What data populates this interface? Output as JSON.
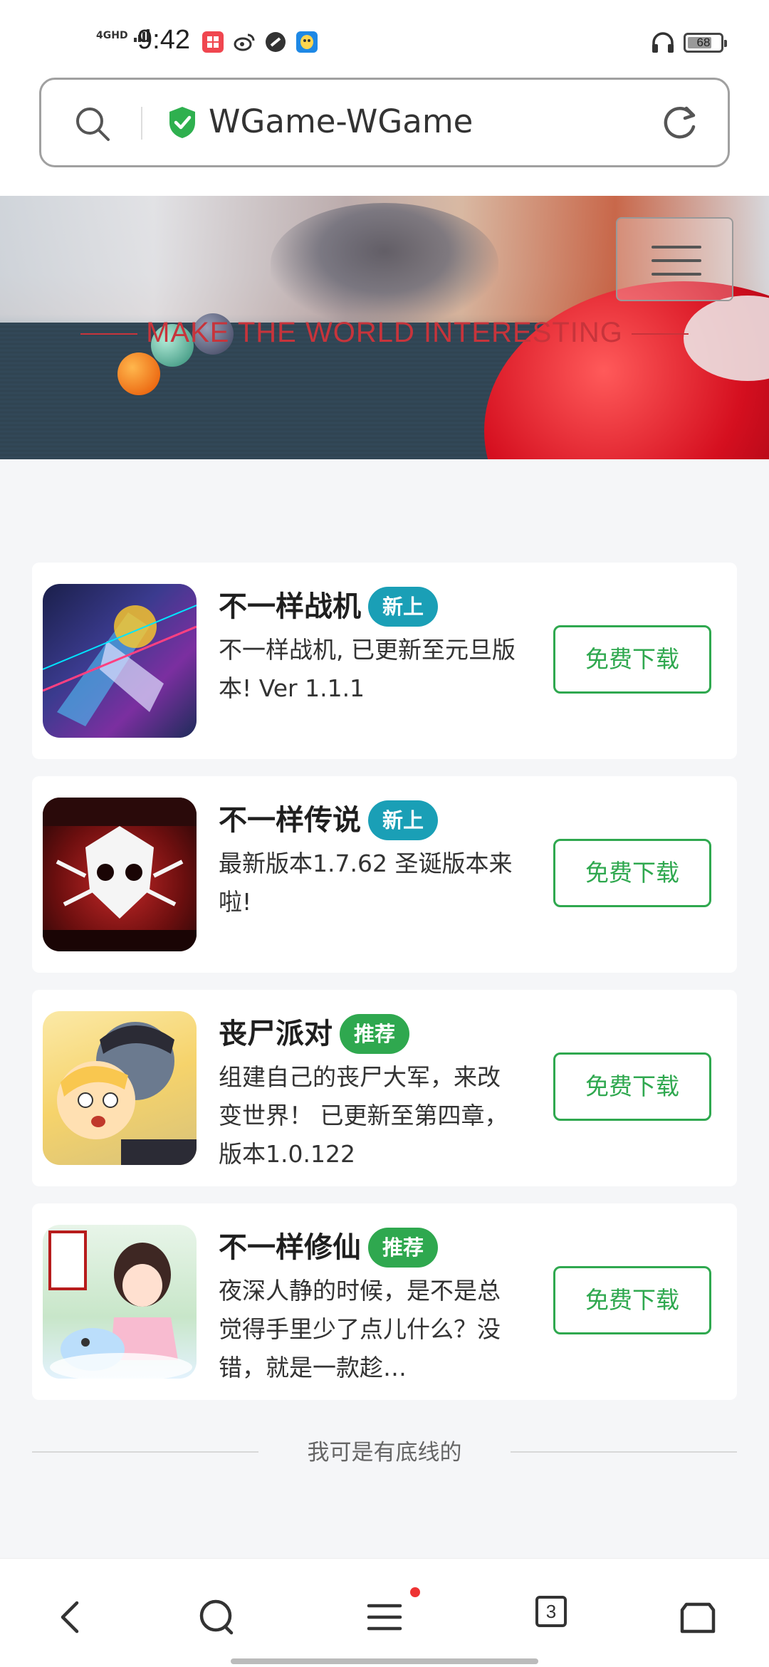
{
  "status_bar": {
    "network": "4GHD",
    "time": "9:42",
    "battery": "68",
    "app_icons": [
      "app-red-icon",
      "weibo-icon",
      "circle-app-icon",
      "qq-icon"
    ],
    "headphone_icon": "headphones-icon"
  },
  "address_bar": {
    "url_text": "WGame-WGame",
    "search_icon": "search-icon",
    "secure_icon": "shield-check-icon",
    "reload_icon": "reload-icon"
  },
  "banner": {
    "tagline": "MAKE THE WORLD INTERESTING",
    "menu_icon": "hamburger-menu-icon"
  },
  "games": [
    {
      "title": "不一样战机",
      "badge": "新上",
      "badge_type": "new",
      "desc": "不一样战机, 已更新至元旦版本! Ver 1.1.1",
      "button": "免费下载"
    },
    {
      "title": "不一样传说",
      "badge": "新上",
      "badge_type": "new",
      "desc": "最新版本1.7.62 圣诞版本来啦!",
      "button": "免费下载"
    },
    {
      "title": "丧尸派对",
      "badge": "推荐",
      "badge_type": "rec",
      "desc": "组建自己的丧尸大军，来改变世界！ 已更新至第四章， 版本1.0.122",
      "button": "免费下载"
    },
    {
      "title": "不一样修仙",
      "badge": "推荐",
      "badge_type": "rec",
      "desc": "夜深人静的时候，是不是总觉得手里少了点儿什么？没错，就是一款趁…",
      "button": "免费下载"
    }
  ],
  "footer_text": "我可是有底线的",
  "bottom_nav": {
    "tab_count": "3",
    "items": [
      "back-icon",
      "search-icon",
      "menu-icon",
      "tabs-icon",
      "home-icon"
    ]
  },
  "colors": {
    "accent_green": "#2fa84f",
    "badge_new": "#1a9fb6",
    "tagline_red": "#c7343b"
  }
}
